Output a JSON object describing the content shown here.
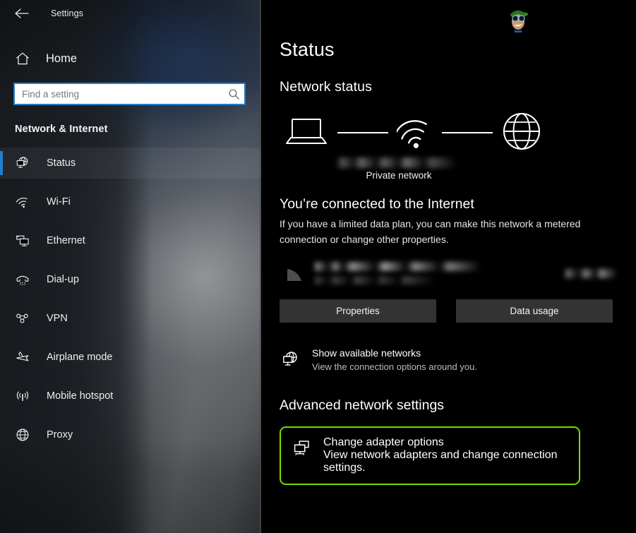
{
  "titlebar": {
    "back_icon": "back-arrow-icon",
    "app_title": "Settings"
  },
  "sidebar": {
    "home": {
      "label": "Home",
      "icon": "home-icon"
    },
    "search": {
      "value": "",
      "placeholder": "Find a setting",
      "icon": "search-icon"
    },
    "category": "Network & Internet",
    "items": [
      {
        "label": "Status",
        "icon": "status-globe-monitor-icon",
        "selected": true
      },
      {
        "label": "Wi-Fi",
        "icon": "wifi-icon",
        "selected": false
      },
      {
        "label": "Ethernet",
        "icon": "ethernet-icon",
        "selected": false
      },
      {
        "label": "Dial-up",
        "icon": "dialup-phone-icon",
        "selected": false
      },
      {
        "label": "VPN",
        "icon": "vpn-icon",
        "selected": false
      },
      {
        "label": "Airplane mode",
        "icon": "airplane-icon",
        "selected": false
      },
      {
        "label": "Mobile hotspot",
        "icon": "hotspot-icon",
        "selected": false
      },
      {
        "label": "Proxy",
        "icon": "proxy-globe-icon",
        "selected": false
      }
    ],
    "accent_color": "#1f7fd0"
  },
  "main": {
    "page_title": "Status",
    "network_status_heading": "Network status",
    "diagram": {
      "device_icon": "laptop-icon",
      "connection_icon": "wifi-signal-icon",
      "internet_icon": "globe-icon",
      "network_name": "",
      "network_type": "Private network"
    },
    "connected": {
      "title": "You’re connected to the Internet",
      "description": "If you have a limited data plan, you can make this network a metered connection or change other properties."
    },
    "usage": {
      "icon": "wifi-signal-icon",
      "network_name": "",
      "period": "",
      "amount": ""
    },
    "buttons": {
      "properties": "Properties",
      "data_usage": "Data usage"
    },
    "show_networks": {
      "icon": "globe-monitor-icon",
      "title": "Show available networks",
      "description": "View the connection options around you."
    },
    "advanced_heading": "Advanced network settings",
    "change_adapter": {
      "icon": "adapter-monitor-icon",
      "title": "Change adapter options",
      "description": "View network adapters and change connection settings.",
      "highlight_color": "#70e000"
    }
  },
  "watermark": {
    "name": "appuals-mascot-logo"
  }
}
